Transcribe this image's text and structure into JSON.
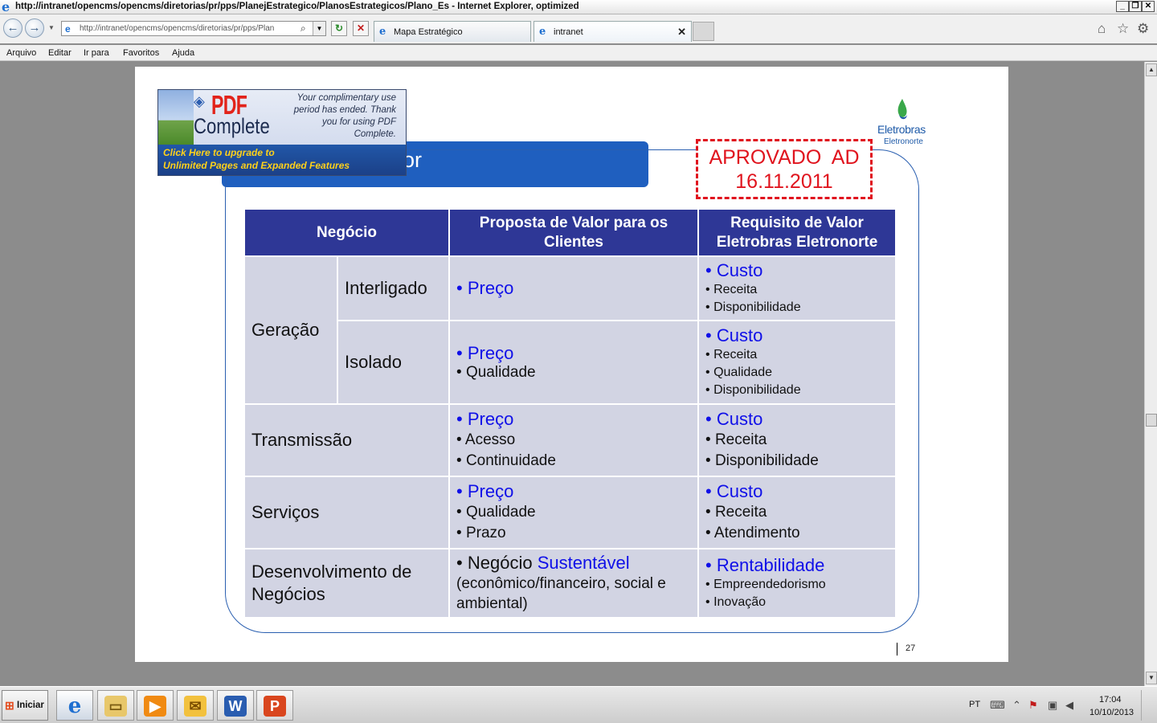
{
  "window": {
    "title": "http://intranet/opencms/opencms/diretorias/pr/pps/PlanejEstrategico/PlanosEstrategicos/Plano_Es - Internet Explorer, optimized",
    "min_label": "_",
    "max_label": "❐",
    "close_label": "✕"
  },
  "address": {
    "url": "http://intranet/opencms/opencms/diretorias/pr/pps/Plan",
    "search_icon": "magnifier-icon",
    "refresh_label": "↻",
    "stop_label": "✕"
  },
  "tabs": [
    {
      "label": "Mapa Estratégico",
      "active": false
    },
    {
      "label": "intranet",
      "active": true,
      "close": "✕"
    }
  ],
  "menu": [
    "Arquivo",
    "Editar",
    "Ir para",
    "Favoritos",
    "Ajuda"
  ],
  "pdf_banner": {
    "logo_top": "PDF",
    "logo_bottom": "Complete",
    "notice": "Your complimentary use period has ended. Thank you for using PDF Complete.",
    "cta_line1": "Click Here to upgrade to",
    "cta_line2": "Unlimited Pages and Expanded Features"
  },
  "slide": {
    "title_visible": "or",
    "stamp_line1": "APROVADO  AD",
    "stamp_line2": "16.11.2011",
    "logo_name": "Eletrobras",
    "logo_sub": "Eletronorte",
    "page_number": "27"
  },
  "table": {
    "headers": [
      "Negócio",
      "Proposta de Valor para os Clientes",
      "Requisito de Valor Eletrobras Eletronorte"
    ],
    "geracao": "Geração",
    "interligado": "Interligado",
    "isolado": "Isolado",
    "transmissao": "Transmissão",
    "servicos": "Serviços",
    "desenvolvimento": "Desenvolvimento de Negócios",
    "bullet": "•",
    "preco": "Preço",
    "custo": "Custo",
    "receita": "Receita",
    "disponibilidade": "Disponibilidade",
    "qualidade": "Qualidade",
    "acesso": "Acesso",
    "continuidade": "Continuidade",
    "prazo": "Prazo",
    "atendimento": "Atendimento",
    "negocio_word": "Negócio",
    "sustentavel": "Sustentável",
    "dev_detail": "(econômico/financeiro, social e ambiental)",
    "rentabilidade": "Rentabilidade",
    "empreendedorismo": "Empreendedorismo",
    "inovacao": "Inovação"
  },
  "taskbar": {
    "start_label": "Iniciar",
    "language": "PT",
    "time": "17:04",
    "date": "10/10/2013",
    "apps": [
      "ie-icon",
      "explorer-folder-icon",
      "media-player-icon",
      "outlook-icon",
      "word-icon",
      "powerpoint-icon"
    ]
  },
  "colors": {
    "header_blue": "#2e3796",
    "cell_gray": "#d2d4e3",
    "accent_blue": "#1010e8",
    "stamp_red": "#e0141e",
    "slide_title_blue": "#1f5fbf"
  }
}
